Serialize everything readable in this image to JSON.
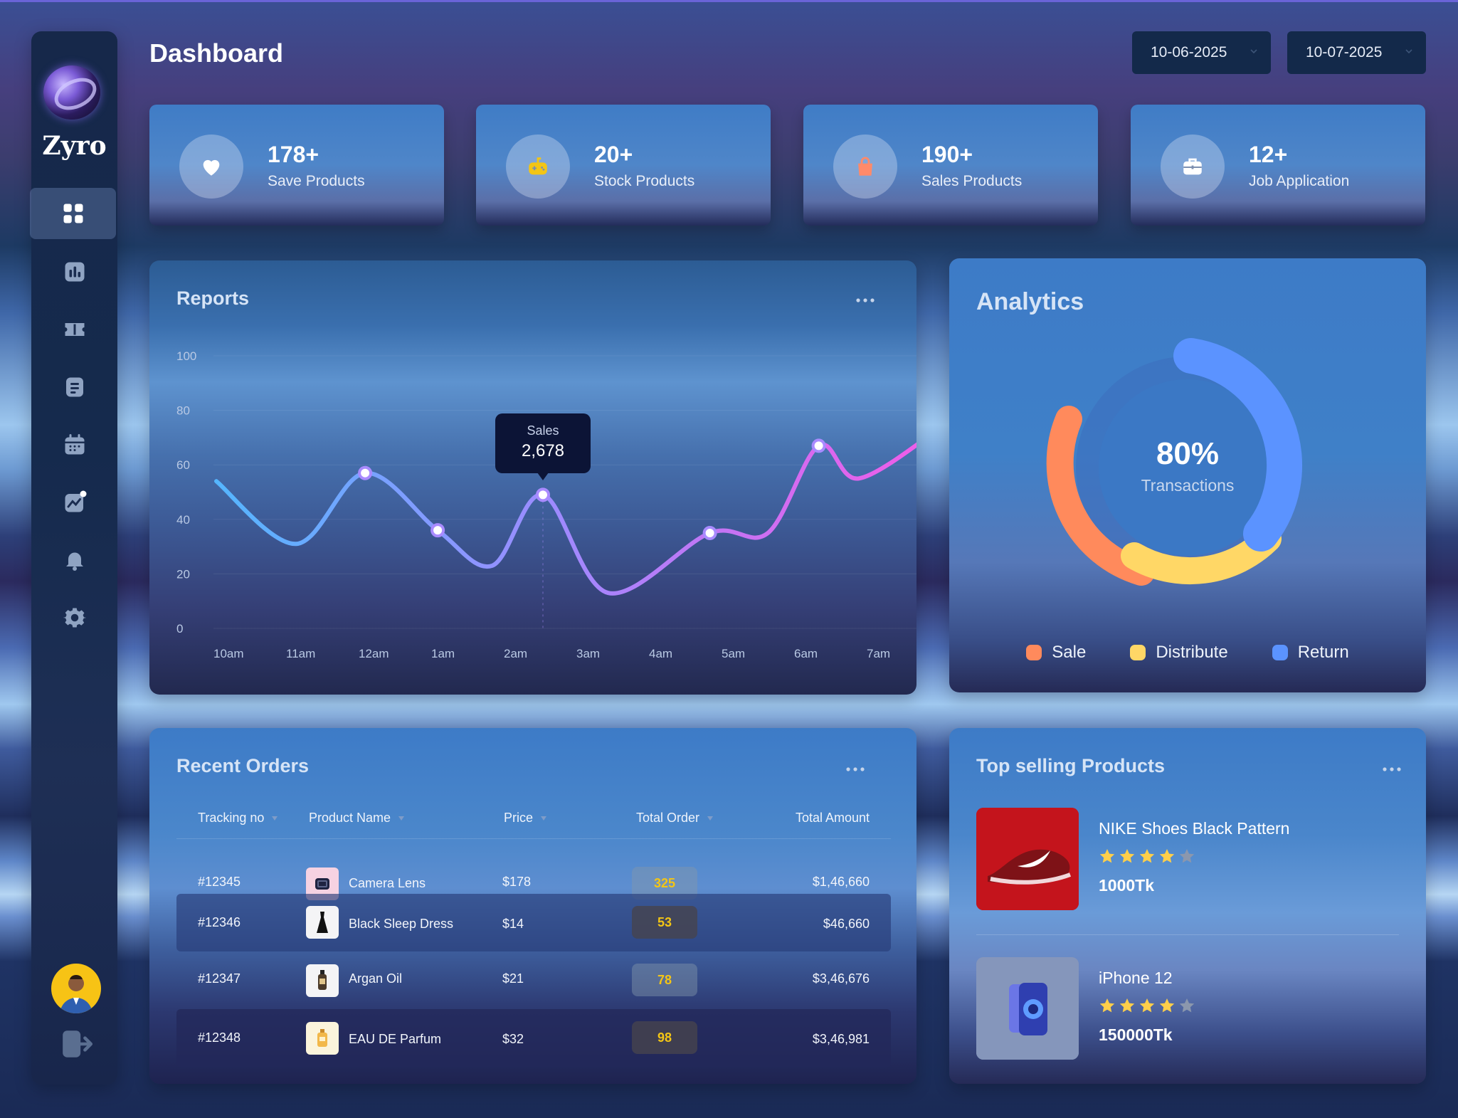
{
  "app": {
    "brand": "Zyro"
  },
  "header": {
    "title": "Dashboard",
    "date_from": "10-06-2025",
    "date_to": "10-07-2025"
  },
  "sidebar": {
    "items": [
      {
        "name": "grid-icon",
        "active": true
      },
      {
        "name": "bar-chart-icon",
        "active": false
      },
      {
        "name": "ticket-icon",
        "active": false
      },
      {
        "name": "document-icon",
        "active": false
      },
      {
        "name": "calendar-icon",
        "active": false
      },
      {
        "name": "trend-icon",
        "active": false
      },
      {
        "name": "bell-icon",
        "active": false
      },
      {
        "name": "gear-icon",
        "active": false
      }
    ]
  },
  "stats": [
    {
      "value": "178+",
      "label": "Save Products",
      "icon": "heart-icon",
      "icon_color": "#ffffff"
    },
    {
      "value": "20+",
      "label": "Stock Products",
      "icon": "gamepad-icon",
      "icon_color": "#f3c515"
    },
    {
      "value": "190+",
      "label": "Sales Products",
      "icon": "bag-icon",
      "icon_color": "#ff8a6a"
    },
    {
      "value": "12+",
      "label": "Job Application",
      "icon": "briefcase-icon",
      "icon_color": "#ffffff"
    }
  ],
  "reports": {
    "title": "Reports",
    "tooltip": {
      "label": "Sales",
      "value": "2,678"
    }
  },
  "chart_data": {
    "type": "line",
    "title": "Reports",
    "categories": [
      "10am",
      "11am",
      "12am",
      "1am",
      "2am",
      "3am",
      "4am",
      "5am",
      "6am",
      "7am"
    ],
    "y_ticks": [
      100,
      80,
      60,
      40,
      20,
      0
    ],
    "ylim": [
      0,
      100
    ],
    "series": [
      {
        "x": [
          0,
          1.1,
          2.05,
          3.05,
          3.8,
          4.5,
          5.4,
          6.8,
          7.6,
          8.3,
          8.85,
          9.95
        ],
        "y": [
          54,
          31,
          57,
          36,
          23,
          49,
          13,
          35,
          35,
          67,
          55,
          73
        ],
        "markers": [
          2.05,
          3.05,
          4.5,
          6.8,
          8.3
        ]
      }
    ],
    "grid": true
  },
  "analytics": {
    "title": "Analytics",
    "center_value": "80%",
    "center_label": "Transactions",
    "legend": [
      {
        "label": "Sale",
        "color": "#ff8a5c"
      },
      {
        "label": "Distribute",
        "color": "#ffd766"
      },
      {
        "label": "Return",
        "color": "#5b93ff"
      }
    ],
    "donut": {
      "type": "pie",
      "segments": [
        {
          "label": "Sale",
          "percent": 30
        },
        {
          "label": "Distribute",
          "percent": 22
        },
        {
          "label": "Return",
          "percent": 35
        }
      ]
    }
  },
  "orders": {
    "title": "Recent Orders",
    "columns": [
      "Tracking no",
      "Product Name",
      "Price",
      "Total Order",
      "Total Amount"
    ],
    "rows": [
      {
        "tracking": "#12345",
        "product": "Camera Lens",
        "price": "$178",
        "total_order": "325",
        "amount": "$1,46,660"
      },
      {
        "tracking": "#12346",
        "product": "Black Sleep Dress",
        "price": "$14",
        "total_order": "53",
        "amount": "$46,660"
      },
      {
        "tracking": "#12347",
        "product": "Argan Oil",
        "price": "$21",
        "total_order": "78",
        "amount": "$3,46,676"
      },
      {
        "tracking": "#12348",
        "product": "EAU DE Parfum",
        "price": "$32",
        "total_order": "98",
        "amount": "$3,46,981"
      }
    ]
  },
  "top_selling": {
    "title": "Top selling Products",
    "products": [
      {
        "name": "NIKE Shoes Black Pattern",
        "rating": 4,
        "price": "1000Tk"
      },
      {
        "name": "iPhone 12",
        "rating": 4,
        "price": "150000Tk"
      }
    ]
  }
}
